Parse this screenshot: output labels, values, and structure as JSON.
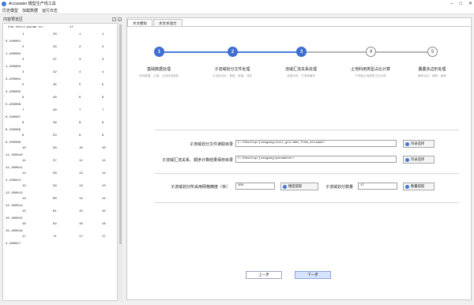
{
  "window": {
    "title": "Accuwater 模型生产线工具"
  },
  "menu": [
    "历史模型",
    "加载数据",
    "运行日志"
  ],
  "left_panel": {
    "title": "内容预览区",
    "param_label": "the third param is:",
    "param_value": "17",
    "rows": [
      {
        "c1": "1",
        "c2": "33",
        "c3": "1",
        "c4": "1",
        "c5": "0.200001"
      },
      {
        "c1": "2",
        "c2": "34",
        "c3": "2",
        "c4": "2",
        "c5": "1.200005"
      },
      {
        "c1": "3",
        "c2": "37",
        "c3": "3",
        "c4": "3",
        "c5": "1.200003"
      },
      {
        "c1": "4",
        "c2": "42",
        "c3": "4",
        "c4": "4",
        "c5": "3.200004"
      },
      {
        "c1": "5",
        "c2": "45",
        "c3": "5",
        "c4": "5",
        "c5": "4.200005"
      },
      {
        "c1": "6",
        "c2": "46",
        "c3": "6",
        "c4": "6",
        "c5": "5.200006"
      },
      {
        "c1": "7",
        "c2": "49",
        "c3": "7",
        "c4": "7",
        "c5": "6.200007"
      },
      {
        "c1": "8",
        "c2": "49",
        "c3": "8",
        "c4": "8",
        "c5": "8.200008"
      },
      {
        "c1": "9",
        "c2": "53",
        "c3": "9",
        "c4": "9",
        "c5": "9.200009"
      },
      {
        "c1": "10",
        "c2": "58",
        "c3": "10",
        "c4": "10",
        "c5": "11.200010"
      },
      {
        "c1": "11",
        "c2": "57",
        "c3": "11",
        "c4": "11",
        "c5": "11.200011"
      },
      {
        "c1": "12",
        "c2": "58",
        "c3": "12",
        "c4": "12",
        "c5": "4.200012"
      },
      {
        "c1": "13",
        "c2": "59",
        "c3": "13",
        "c4": "13",
        "c5": "12.200013"
      },
      {
        "c1": "14",
        "c2": "60",
        "c3": "14",
        "c4": "14",
        "c5": "12.200014"
      },
      {
        "c1": "15",
        "c2": "61",
        "c3": "15",
        "c4": "15",
        "c5": "15.200015"
      },
      {
        "c1": "16",
        "c2": "64",
        "c3": "16",
        "c4": "16",
        "c5": "15.200016"
      },
      {
        "c1": "17",
        "c2": "71",
        "c3": "17",
        "c4": "17",
        "c5": "4.200017"
      }
    ]
  },
  "tabs": [
    "水文模拟",
    "水文水动力"
  ],
  "steps": [
    {
      "num": "1",
      "title": "基础数据处理",
      "sub": "河流数据、土壤、土地利用类型",
      "state": "done"
    },
    {
      "num": "2",
      "title": "子流域划分文件处理",
      "sub": "汇流区划分、坡度、坡度、流向",
      "state": "done"
    },
    {
      "num": "3",
      "title": "流域汇流关系处理",
      "sub": "流域分布、子流域编号",
      "state": "done"
    },
    {
      "num": "4",
      "title": "土地利用类型占比计算",
      "sub": "子流域土地类型占比计算",
      "state": "todo"
    },
    {
      "num": "5",
      "title": "叠叠多边形处理",
      "sub": "面积合并、面积、面积",
      "state": "todo"
    }
  ],
  "form": {
    "read_dir_label": "子流域划分文件读取目录",
    "read_dir_value": "C:/Develop/jiangang/init_gis/dem_from_arcswat/",
    "read_dir_btn": "目录选择",
    "save_dir_label": "子流域汇流关系、顺序计算结果保存目录",
    "save_dir_value": "C:/Develop/jiangang/parameter/",
    "save_dir_btn": "目录选择",
    "area_label": "子流域划分所采用网格精度（米）",
    "area_value": "300",
    "area_btn": "精度提取",
    "count_label": "子流域划分数量",
    "count_value": "17",
    "count_btn": "数量提取"
  },
  "nav": {
    "prev": "上一步",
    "next": "下一步"
  },
  "colors": {
    "accent": "#3f6fd0",
    "inactive": "#b8b8b8"
  }
}
